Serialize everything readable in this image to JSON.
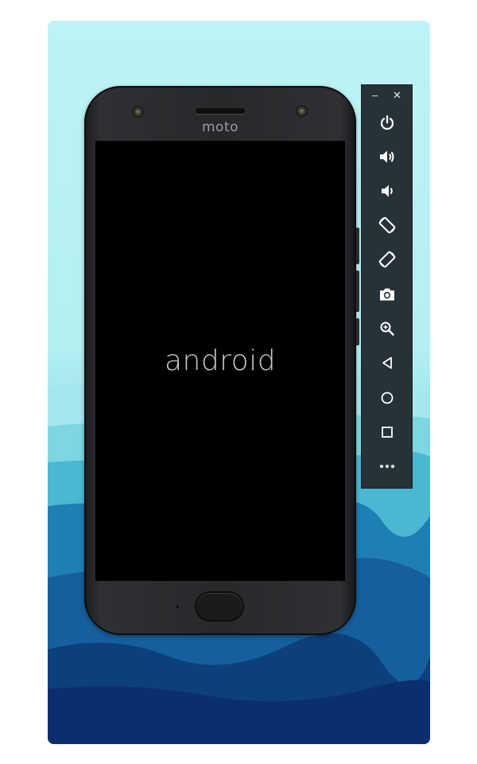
{
  "device": {
    "brand": "moto",
    "boot_text": "android"
  },
  "window_controls": {
    "minimize": "–",
    "close": "✕"
  },
  "toolbar": {
    "buttons": [
      {
        "id": "power",
        "icon": "power-icon"
      },
      {
        "id": "volume-up",
        "icon": "volume-up-icon"
      },
      {
        "id": "volume-down",
        "icon": "volume-down-icon"
      },
      {
        "id": "rotate-left",
        "icon": "rotate-left-icon"
      },
      {
        "id": "rotate-right",
        "icon": "rotate-right-icon"
      },
      {
        "id": "screenshot",
        "icon": "camera-icon"
      },
      {
        "id": "zoom",
        "icon": "zoom-in-icon"
      },
      {
        "id": "back",
        "icon": "back-triangle-icon"
      },
      {
        "id": "home",
        "icon": "home-circle-icon"
      },
      {
        "id": "overview",
        "icon": "overview-square-icon"
      },
      {
        "id": "more",
        "icon": "more-horizontal-icon"
      }
    ]
  },
  "colors": {
    "toolbar_bg": "#263238",
    "sky_top": "#bdf3f5",
    "sea_deep": "#0b2f6e"
  }
}
